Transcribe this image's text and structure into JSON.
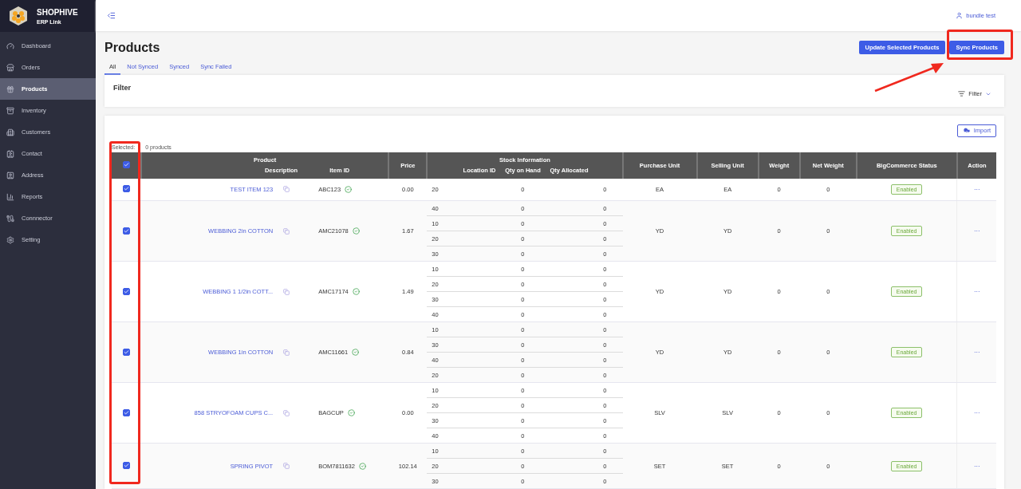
{
  "brand": {
    "name": "SHOPHIVE",
    "subtitle": "ERP Link"
  },
  "sidebar": {
    "items": [
      {
        "label": "Dashboard",
        "selected": false
      },
      {
        "label": "Orders",
        "selected": false
      },
      {
        "label": "Products",
        "selected": true
      },
      {
        "label": "Inventory",
        "selected": false
      },
      {
        "label": "Customers",
        "selected": false
      },
      {
        "label": "Contact",
        "selected": false
      },
      {
        "label": "Address",
        "selected": false
      },
      {
        "label": "Reports",
        "selected": false
      },
      {
        "label": "Connnector",
        "selected": false
      },
      {
        "label": "Setting",
        "selected": false
      }
    ]
  },
  "topbar": {
    "user": "bundle test"
  },
  "page": {
    "title": "Products",
    "buttons": [
      "Update Selected Products",
      "Sync Products"
    ]
  },
  "tabs": [
    {
      "label": "All",
      "selected": true
    },
    {
      "label": "Not Synced",
      "selected": false
    },
    {
      "label": "Synced",
      "selected": false
    },
    {
      "label": "Sync Failed",
      "selected": false
    }
  ],
  "filter": {
    "title": "Filter",
    "button": "Filter"
  },
  "table": {
    "import_button": "Import",
    "selected_label": "Selected:",
    "selected_count": "0 products",
    "all_checked": true,
    "group_headers": {
      "product": "Product",
      "stock": "Stock Information"
    },
    "columns": {
      "description": "Description",
      "item_id": "Item ID",
      "price": "Price",
      "location": "Location ID",
      "on_hand": "Qty on Hand",
      "allocated": "Qty Allocated",
      "purchase_unit": "Purchase Unit",
      "selling_unit": "Selling Unit",
      "weight": "Weight",
      "net_weight": "Net Weight",
      "status": "BigCommerce Status",
      "action": "Action"
    },
    "rows": [
      {
        "checked": true,
        "description": "TEST ITEM 123",
        "item_id": "ABC123",
        "price": "0.00",
        "stock": [
          {
            "location": "20",
            "on_hand": "0",
            "allocated": "0"
          }
        ],
        "purchase_unit": "EA",
        "selling_unit": "EA",
        "weight": "0",
        "net_weight": "0",
        "status": "Enabled",
        "action": "···"
      },
      {
        "checked": true,
        "description": "WEBBING 2in COTTON",
        "item_id": "AMC21078",
        "price": "1.67",
        "stock": [
          {
            "location": "40",
            "on_hand": "0",
            "allocated": "0"
          },
          {
            "location": "10",
            "on_hand": "0",
            "allocated": "0"
          },
          {
            "location": "20",
            "on_hand": "0",
            "allocated": "0"
          },
          {
            "location": "30",
            "on_hand": "0",
            "allocated": "0"
          }
        ],
        "purchase_unit": "YD",
        "selling_unit": "YD",
        "weight": "0",
        "net_weight": "0",
        "status": "Enabled",
        "action": "···"
      },
      {
        "checked": true,
        "description": "WEBBING 1 1/2in COTT...",
        "item_id": "AMC17174",
        "price": "1.49",
        "stock": [
          {
            "location": "10",
            "on_hand": "0",
            "allocated": "0"
          },
          {
            "location": "20",
            "on_hand": "0",
            "allocated": "0"
          },
          {
            "location": "30",
            "on_hand": "0",
            "allocated": "0"
          },
          {
            "location": "40",
            "on_hand": "0",
            "allocated": "0"
          }
        ],
        "purchase_unit": "YD",
        "selling_unit": "YD",
        "weight": "0",
        "net_weight": "0",
        "status": "Enabled",
        "action": "···"
      },
      {
        "checked": true,
        "description": "WEBBING 1in COTTON",
        "item_id": "AMC11661",
        "price": "0.84",
        "stock": [
          {
            "location": "10",
            "on_hand": "0",
            "allocated": "0"
          },
          {
            "location": "30",
            "on_hand": "0",
            "allocated": "0"
          },
          {
            "location": "40",
            "on_hand": "0",
            "allocated": "0"
          },
          {
            "location": "20",
            "on_hand": "0",
            "allocated": "0"
          }
        ],
        "purchase_unit": "YD",
        "selling_unit": "YD",
        "weight": "0",
        "net_weight": "0",
        "status": "Enabled",
        "action": "···"
      },
      {
        "checked": true,
        "description": "858 STRYOFOAM CUPS C...",
        "item_id": "BAGCUP",
        "price": "0.00",
        "stock": [
          {
            "location": "10",
            "on_hand": "0",
            "allocated": "0"
          },
          {
            "location": "20",
            "on_hand": "0",
            "allocated": "0"
          },
          {
            "location": "30",
            "on_hand": "0",
            "allocated": "0"
          },
          {
            "location": "40",
            "on_hand": "0",
            "allocated": "0"
          }
        ],
        "purchase_unit": "SLV",
        "selling_unit": "SLV",
        "weight": "0",
        "net_weight": "0",
        "status": "Enabled",
        "action": "···"
      },
      {
        "checked": true,
        "description": "SPRING PIVOT",
        "item_id": "BOM7811632",
        "price": "102.14",
        "stock": [
          {
            "location": "10",
            "on_hand": "0",
            "allocated": "0"
          },
          {
            "location": "20",
            "on_hand": "0",
            "allocated": "0"
          },
          {
            "location": "30",
            "on_hand": "0",
            "allocated": "0"
          }
        ],
        "purchase_unit": "SET",
        "selling_unit": "SET",
        "weight": "0",
        "net_weight": "0",
        "status": "Enabled",
        "action": "···"
      }
    ]
  }
}
